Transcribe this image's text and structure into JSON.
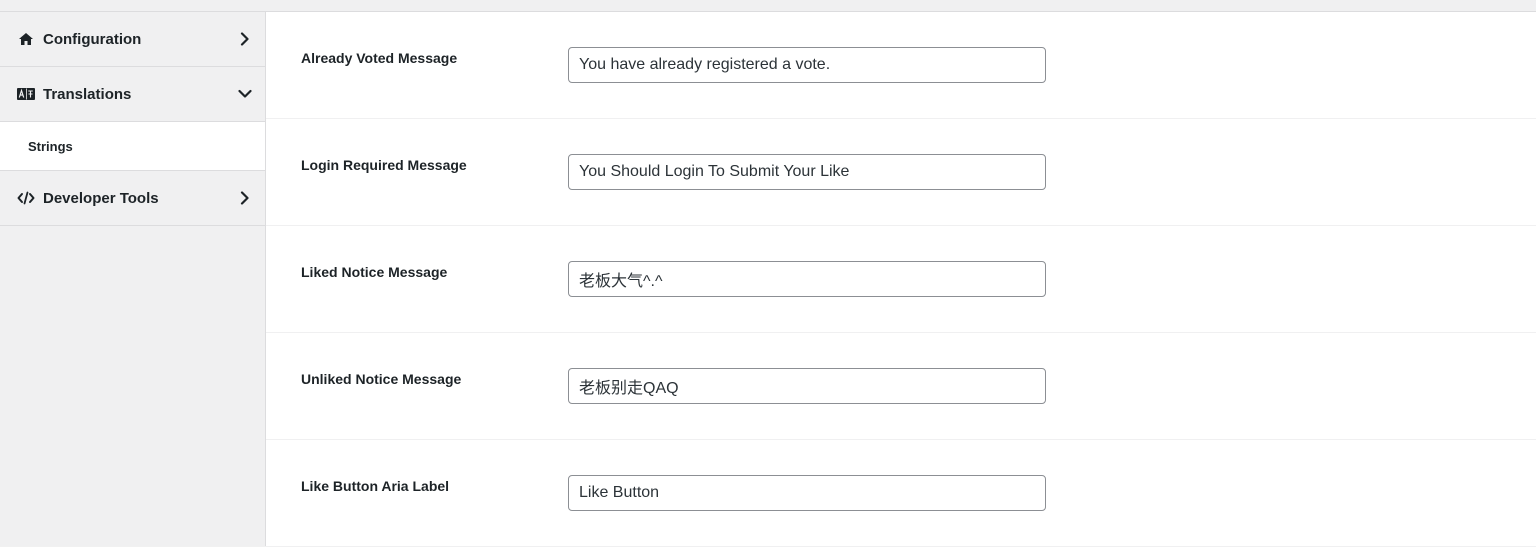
{
  "sidebar": {
    "items": [
      {
        "label": "Configuration",
        "icon": "home-icon",
        "chevron": "chevron-right-icon"
      },
      {
        "label": "Translations",
        "icon": "translate-icon",
        "chevron": "chevron-down-icon"
      },
      {
        "label": "Strings"
      },
      {
        "label": "Developer Tools",
        "icon": "code-icon",
        "chevron": "chevron-right-icon"
      }
    ]
  },
  "fields": [
    {
      "label": "Already Voted Message",
      "value": "You have already registered a vote."
    },
    {
      "label": "Login Required Message",
      "value": "You Should Login To Submit Your Like"
    },
    {
      "label": "Liked Notice Message",
      "value": "老板大气^.^"
    },
    {
      "label": "Unliked Notice Message",
      "value": "老板别走QAQ"
    },
    {
      "label": "Like Button Aria Label",
      "value": "Like Button"
    }
  ]
}
